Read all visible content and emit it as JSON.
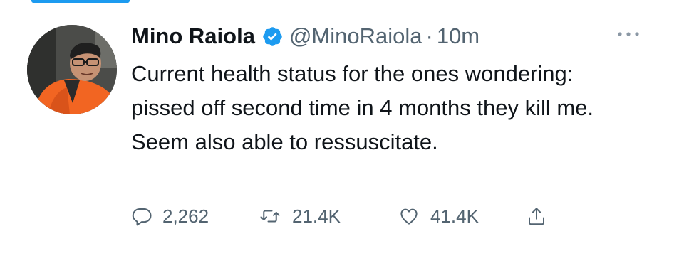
{
  "tweet": {
    "author": {
      "display_name": "Mino Raiola",
      "handle": "@MinoRaiola",
      "verified": true,
      "avatar_icon": "profile-photo"
    },
    "separator": "·",
    "time": "10m",
    "text": "Current health status for the ones wondering: pissed off second time in 4 months they kill me. Seem also able to ressuscitate.",
    "actions": {
      "reply": {
        "icon": "reply-icon",
        "count": "2,262"
      },
      "retweet": {
        "icon": "retweet-icon",
        "count": "21.4K"
      },
      "like": {
        "icon": "heart-icon",
        "count": "41.4K"
      },
      "share": {
        "icon": "share-icon"
      }
    }
  },
  "colors": {
    "text": "#0f1419",
    "secondary": "#536471",
    "accent": "#1d9bf0",
    "divider": "#e6ecf0"
  }
}
